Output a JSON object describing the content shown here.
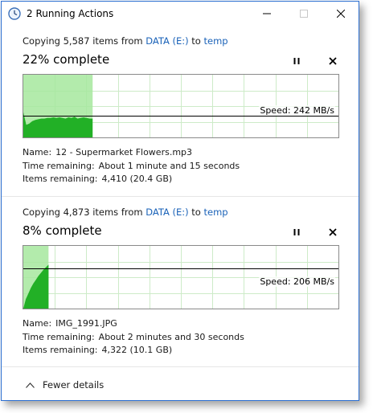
{
  "window": {
    "title": "2 Running Actions"
  },
  "operations": [
    {
      "copying_prefix": "Copying 5,587 items from ",
      "source": "DATA (E:)",
      "mid": " to ",
      "destination": "temp",
      "percent_text": "22% complete",
      "progress": 0.22,
      "speed_text": "Speed: 242 MB/s",
      "speed_level": 0.35,
      "name_label": "Name:",
      "name_value": "12 - Supermarket Flowers.mp3",
      "time_label": "Time remaining:",
      "time_value": "About 1 minute and 15 seconds",
      "items_label": "Items remaining:",
      "items_value": "4,410 (20.4 GB)",
      "history": [
        0.4,
        0.2,
        0.22,
        0.26,
        0.28,
        0.29,
        0.3,
        0.3,
        0.31,
        0.31,
        0.32,
        0.31,
        0.32,
        0.31,
        0.3,
        0.32,
        0.31,
        0.33,
        0.3,
        0.31,
        0.32,
        0.31,
        0.3,
        0.3
      ]
    },
    {
      "copying_prefix": "Copying 4,873 items from ",
      "source": "DATA (E:)",
      "mid": " to ",
      "destination": "temp",
      "percent_text": "8% complete",
      "progress": 0.08,
      "speed_text": "Speed: 206 MB/s",
      "speed_level": 0.64,
      "name_label": "Name:",
      "name_value": "IMG_1991.JPG",
      "time_label": "Time remaining:",
      "time_value": "About 2 minutes and 30 seconds",
      "items_label": "Items remaining:",
      "items_value": "4,322 (10.1 GB)",
      "history": [
        0.0,
        0.15,
        0.24,
        0.33,
        0.4,
        0.46,
        0.52,
        0.57,
        0.62,
        0.66,
        0.7
      ]
    }
  ],
  "footer": {
    "fewer_details": "Fewer details"
  },
  "colors": {
    "accent": "#1a62b8",
    "graph_fill": "#22b026",
    "graph_progress": "#a6e89d",
    "grid": "#cdebc8",
    "border": "#2b6ed1"
  },
  "icons": {
    "app": "clock-icon",
    "pause": "pause-icon",
    "cancel": "close-icon",
    "chevron": "chevron-up-icon"
  }
}
